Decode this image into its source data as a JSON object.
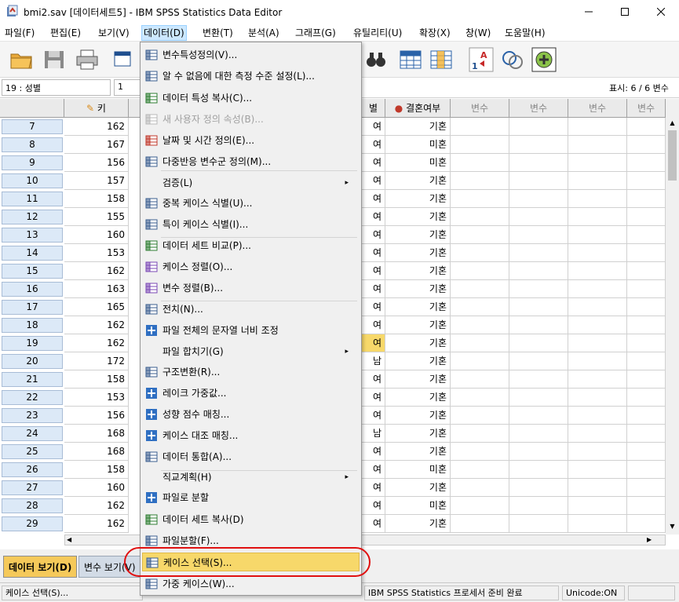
{
  "window": {
    "title": "bmi2.sav [데이터세트5] - IBM SPSS Statistics Data Editor",
    "minimize_icon": "minimize-icon",
    "maximize_icon": "maximize-icon",
    "close_icon": "close-icon"
  },
  "menubar": {
    "items": [
      {
        "label": "파일(F)"
      },
      {
        "label": "편집(E)"
      },
      {
        "label": "보기(V)"
      },
      {
        "label": "데이터(D)"
      },
      {
        "label": "변환(T)"
      },
      {
        "label": "분석(A)"
      },
      {
        "label": "그래프(G)"
      },
      {
        "label": "유틸리티(U)"
      },
      {
        "label": "확장(X)"
      },
      {
        "label": "창(W)"
      },
      {
        "label": "도움말(H)"
      }
    ]
  },
  "editrow": {
    "cell_name": "19 : 성별",
    "cell_value": "1",
    "show_count": "표시: 6 / 6 변수"
  },
  "grid": {
    "headers": [
      "키",
      "별",
      "결혼여부",
      "변수",
      "변수",
      "변수",
      "변수"
    ],
    "rows": [
      {
        "n": "7",
        "height": "162",
        "sex": "여",
        "married": "기혼"
      },
      {
        "n": "8",
        "height": "167",
        "sex": "여",
        "married": "미혼"
      },
      {
        "n": "9",
        "height": "156",
        "sex": "여",
        "married": "미혼"
      },
      {
        "n": "10",
        "height": "157",
        "sex": "여",
        "married": "기혼"
      },
      {
        "n": "11",
        "height": "158",
        "sex": "여",
        "married": "기혼"
      },
      {
        "n": "12",
        "height": "155",
        "sex": "여",
        "married": "기혼"
      },
      {
        "n": "13",
        "height": "160",
        "sex": "여",
        "married": "기혼"
      },
      {
        "n": "14",
        "height": "153",
        "sex": "여",
        "married": "기혼"
      },
      {
        "n": "15",
        "height": "162",
        "sex": "여",
        "married": "기혼"
      },
      {
        "n": "16",
        "height": "163",
        "sex": "여",
        "married": "기혼"
      },
      {
        "n": "17",
        "height": "165",
        "sex": "여",
        "married": "기혼"
      },
      {
        "n": "18",
        "height": "162",
        "sex": "여",
        "married": "기혼"
      },
      {
        "n": "19",
        "height": "162",
        "sex": "여",
        "married": "기혼"
      },
      {
        "n": "20",
        "height": "172",
        "sex": "남",
        "married": "기혼"
      },
      {
        "n": "21",
        "height": "158",
        "sex": "여",
        "married": "기혼"
      },
      {
        "n": "22",
        "height": "153",
        "sex": "여",
        "married": "기혼"
      },
      {
        "n": "23",
        "height": "156",
        "sex": "여",
        "married": "기혼"
      },
      {
        "n": "24",
        "height": "168",
        "sex": "남",
        "married": "기혼"
      },
      {
        "n": "25",
        "height": "168",
        "sex": "여",
        "married": "기혼"
      },
      {
        "n": "26",
        "height": "158",
        "sex": "여",
        "married": "미혼"
      },
      {
        "n": "27",
        "height": "160",
        "sex": "여",
        "married": "기혼"
      },
      {
        "n": "28",
        "height": "162",
        "sex": "여",
        "married": "미혼"
      },
      {
        "n": "29",
        "height": "162",
        "sex": "여",
        "married": "기혼"
      }
    ]
  },
  "tabs": {
    "data_view": "데이터 보기(D)",
    "var_view": "변수 보기(V)"
  },
  "statusbar": {
    "left": "케이스 선택(S)...",
    "processor": "IBM SPSS Statistics 프로세서 준비 완료",
    "unicode": "Unicode:ON"
  },
  "dropdown": {
    "items": [
      {
        "label": "변수특성정의(V)...",
        "icon": "define-properties-icon"
      },
      {
        "label": "알 수 없음에 대한 측정 수준 설정(L)...",
        "icon": "unknown-level-icon"
      },
      {
        "label": "데이터 특성 복사(C)...",
        "icon": "copy-properties-icon"
      },
      {
        "label": "새 사용자 정의 속성(B)...",
        "icon": "custom-attribute-icon"
      },
      {
        "label": "날짜 및 시간 정의(E)...",
        "icon": "date-time-icon"
      },
      {
        "label": "다중반응 변수군 정의(M)...",
        "icon": "multiple-response-icon"
      },
      {
        "label": "검증(L)",
        "icon": ""
      },
      {
        "label": "중복 케이스 식별(U)...",
        "icon": "duplicate-cases-icon"
      },
      {
        "label": "특이 케이스 식별(I)...",
        "icon": "unusual-cases-icon"
      },
      {
        "label": "데이터 세트 비교(P)...",
        "icon": "compare-datasets-icon"
      },
      {
        "label": "케이스 정렬(O)...",
        "icon": "sort-cases-icon"
      },
      {
        "label": "변수 정렬(B)...",
        "icon": "sort-variables-icon"
      },
      {
        "label": "전치(N)...",
        "icon": "transpose-icon"
      },
      {
        "label": "파일 전체의 문자열 너비 조정",
        "icon": "plus-icon"
      },
      {
        "label": "파일 합치기(G)",
        "icon": ""
      },
      {
        "label": "구조변환(R)...",
        "icon": "restructure-icon"
      },
      {
        "label": "레이크 가중값...",
        "icon": "plus-icon"
      },
      {
        "label": "성향 점수 매칭...",
        "icon": "plus-icon"
      },
      {
        "label": "케이스 대조 매칭...",
        "icon": "plus-icon"
      },
      {
        "label": "데이터 통합(A)...",
        "icon": "aggregate-icon"
      },
      {
        "label": "직교계획(H)",
        "icon": ""
      },
      {
        "label": "파일로 분할",
        "icon": "plus-icon"
      },
      {
        "label": "데이터 세트 복사(D)",
        "icon": "copy-dataset-icon"
      },
      {
        "label": "파일분할(F)...",
        "icon": "split-file-icon"
      },
      {
        "label": "케이스 선택(S)...",
        "icon": "select-cases-icon"
      },
      {
        "label": "가중 케이스(W)...",
        "icon": "weight-cases-icon"
      }
    ],
    "submenu_arrow": "▸"
  },
  "colors": {
    "highlight": "#f7d86a",
    "menu_active": "#cce8ff",
    "annotation": "#e01010",
    "tab_active": "#f5c95a"
  }
}
